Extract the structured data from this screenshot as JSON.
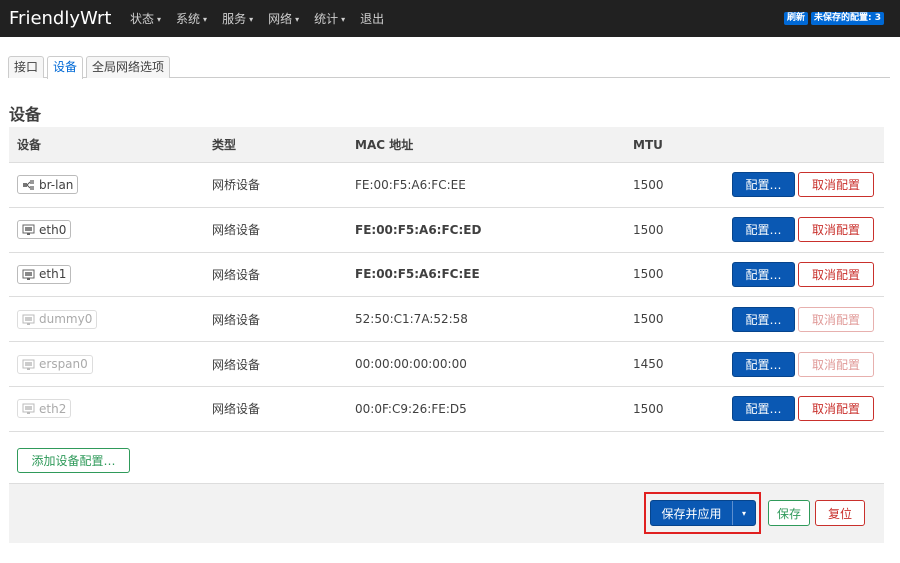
{
  "navbar": {
    "brand": "FriendlyWrt",
    "menu": [
      "状态",
      "系统",
      "服务",
      "网络",
      "统计",
      "退出"
    ],
    "caret": "▾",
    "refresh": "刷新",
    "unsaved": "未保存的配置: 3"
  },
  "tabs": [
    "接口",
    "设备",
    "全局网络选项"
  ],
  "section_title": "设备",
  "table": {
    "headers": [
      "设备",
      "类型",
      "MAC 地址",
      "MTU"
    ],
    "rows": [
      {
        "name": "br-lan",
        "type": "网桥设备",
        "mac": "FE:00:F5:A6:FC:EE",
        "mtu": "1500"
      },
      {
        "name": "eth0",
        "type": "网络设备",
        "mac": "FE:00:F5:A6:FC:ED",
        "mtu": "1500"
      },
      {
        "name": "eth1",
        "type": "网络设备",
        "mac": "FE:00:F5:A6:FC:EE",
        "mtu": "1500"
      },
      {
        "name": "dummy0",
        "type": "网络设备",
        "mac": "52:50:C1:7A:52:58",
        "mtu": "1500"
      },
      {
        "name": "erspan0",
        "type": "网络设备",
        "mac": "00:00:00:00:00:00",
        "mtu": "1450"
      },
      {
        "name": "eth2",
        "type": "网络设备",
        "mac": "00:0F:C9:26:FE:D5",
        "mtu": "1500"
      }
    ],
    "edit_label": "配置…",
    "delete_label": "取消配置"
  },
  "add_device_label": "添加设备配置…",
  "footer": {
    "apply_label": "保存并应用",
    "dropdown_caret": "▾",
    "save_label": "保存",
    "reset_label": "复位"
  },
  "colors": {
    "primary": "#0a58b3",
    "positive": "#2f9a5a",
    "negative": "#c9302c",
    "highlight": "#e02020"
  }
}
